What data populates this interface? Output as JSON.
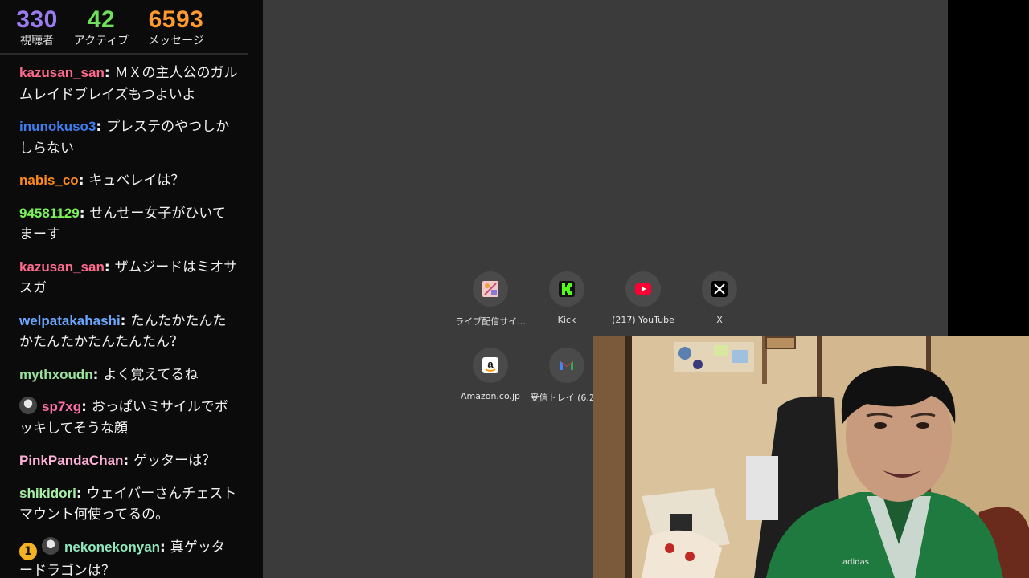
{
  "stats": {
    "viewers": {
      "value": "330",
      "label": "視聴者",
      "color": "#9b7bf0"
    },
    "active": {
      "value": "42",
      "label": "アクティブ",
      "color": "#6fe05b"
    },
    "messages": {
      "value": "6593",
      "label": "メッセージ",
      "color": "#ff9a2e"
    }
  },
  "chat": [
    {
      "user": "kazusan_san",
      "color": "#ff6b8f",
      "text": "ＭＸの主人公のガルムレイドブレイズもつよいよ",
      "badges": []
    },
    {
      "user": "inunokuso3",
      "color": "#3f7df0",
      "text": "プレステのやつしかしらない",
      "badges": []
    },
    {
      "user": "nabis_co",
      "color": "#ff8a1c",
      "text": "キュベレイは？",
      "badges": []
    },
    {
      "user": "94581129",
      "color": "#7cf25a",
      "text": "せんせー女子がひいてまーす",
      "badges": []
    },
    {
      "user": "kazusan_san",
      "color": "#ff6b8f",
      "text": "ザムジードはミオサスガ",
      "badges": []
    },
    {
      "user": "welpatakahashi",
      "color": "#6aa7ff",
      "text": "たんたかたんたかたんたかたんたんたん？",
      "badges": []
    },
    {
      "user": "mythxoudn",
      "color": "#9be39c",
      "text": "よく覚えてるね",
      "badges": []
    },
    {
      "user": "sp7xg",
      "color": "#ff6fa6",
      "text": "おっぱいミサイルでボッキしてそうな顔",
      "badges": [
        "avatar"
      ]
    },
    {
      "user": "PinkPandaChan",
      "color": "#ffb0d8",
      "text": "ゲッターは？",
      "badges": []
    },
    {
      "user": "shikidori",
      "color": "#a8f0a8",
      "text": "ウェイバーさんチェストマウント何使ってるの。",
      "badges": []
    },
    {
      "user": "nekonekonyan",
      "color": "#8fe8c0",
      "text": "真ゲッタードラゴンは？",
      "badges": [
        "sub",
        "avatar"
      ],
      "sub_badge": "1"
    }
  ],
  "shortcuts": [
    {
      "title": "ライブ配信サイ...",
      "icon": "live-site-icon"
    },
    {
      "title": "Kick",
      "icon": "kick-icon"
    },
    {
      "title": "(217) YouTube",
      "icon": "youtube-icon"
    },
    {
      "title": "X",
      "icon": "x-icon"
    },
    {
      "title": "Amazon.co.jp",
      "icon": "amazon-icon"
    },
    {
      "title": "受信トレイ (6,2...",
      "icon": "gmail-icon"
    }
  ]
}
